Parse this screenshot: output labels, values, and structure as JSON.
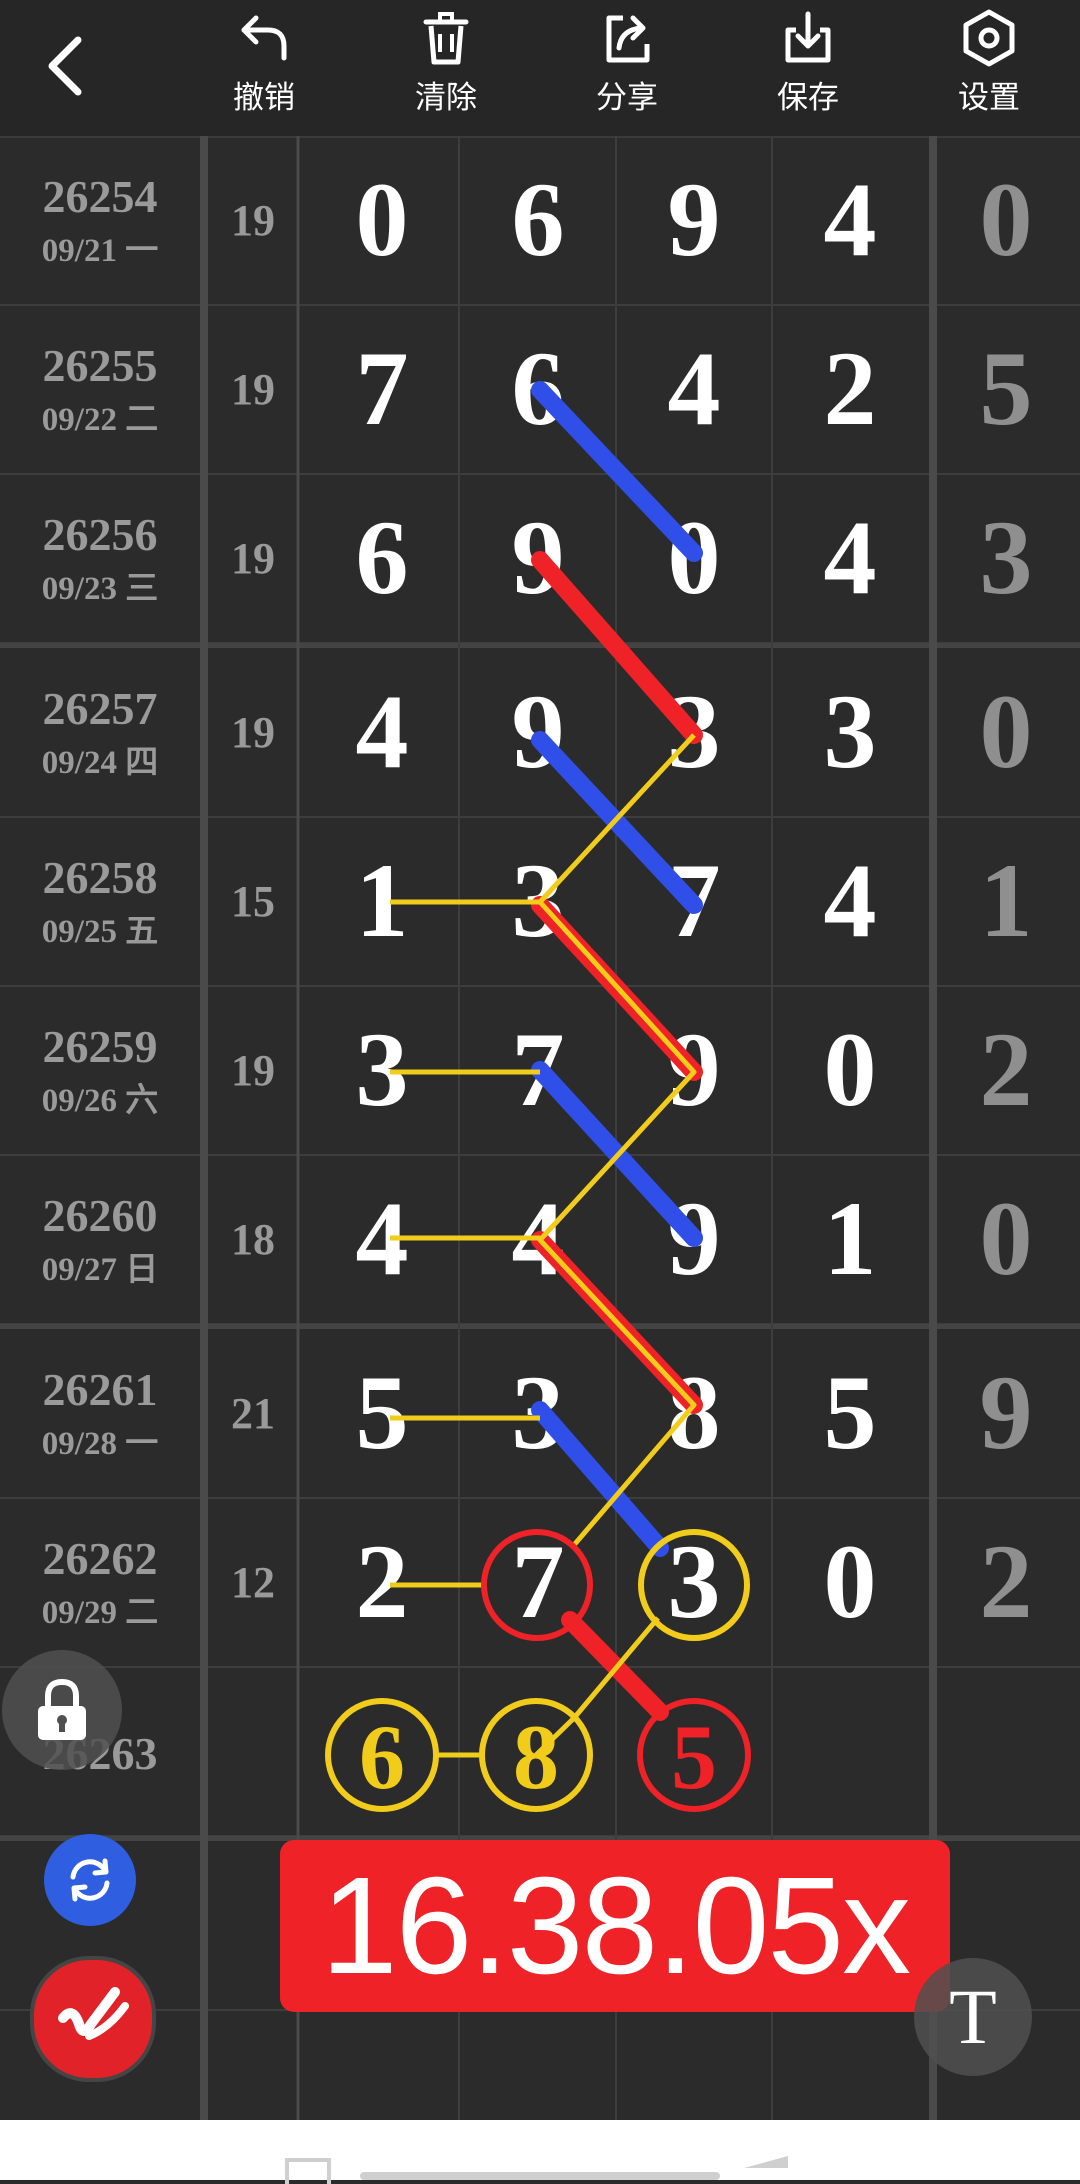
{
  "toolbar": {
    "undo_label": "撤销",
    "clear_label": "清除",
    "share_label": "分享",
    "save_label": "保存",
    "settings_label": "设置"
  },
  "rows": [
    {
      "issue": "26254",
      "date": "09/21 一",
      "sum": "19",
      "d": [
        "0",
        "6",
        "9",
        "4"
      ],
      "last": "0"
    },
    {
      "issue": "26255",
      "date": "09/22 二",
      "sum": "19",
      "d": [
        "7",
        "6",
        "4",
        "2"
      ],
      "last": "5"
    },
    {
      "issue": "26256",
      "date": "09/23 三",
      "sum": "19",
      "d": [
        "6",
        "9",
        "0",
        "4"
      ],
      "last": "3"
    },
    {
      "issue": "26257",
      "date": "09/24 四",
      "sum": "19",
      "d": [
        "4",
        "9",
        "3",
        "3"
      ],
      "last": "0"
    },
    {
      "issue": "26258",
      "date": "09/25 五",
      "sum": "15",
      "d": [
        "1",
        "3",
        "7",
        "4"
      ],
      "last": "1"
    },
    {
      "issue": "26259",
      "date": "09/26 六",
      "sum": "19",
      "d": [
        "3",
        "7",
        "9",
        "0"
      ],
      "last": "2"
    },
    {
      "issue": "26260",
      "date": "09/27 日",
      "sum": "18",
      "d": [
        "4",
        "4",
        "9",
        "1"
      ],
      "last": "0"
    },
    {
      "issue": "26261",
      "date": "09/28 一",
      "sum": "21",
      "d": [
        "5",
        "3",
        "8",
        "5"
      ],
      "last": "9"
    },
    {
      "issue": "26262",
      "date": "09/29 二",
      "sum": "12",
      "d": [
        "2",
        "7",
        "3",
        "0"
      ],
      "last": "2"
    }
  ],
  "next_issue": "26263",
  "predicted": {
    "yellow_1": "6",
    "yellow_2": "8",
    "red_3": "5"
  },
  "result_text": "16.38.05x",
  "text_tool_label": "T",
  "colors": {
    "background": "#2b2b2b",
    "red": "#ee2227",
    "blue": "#2f4fe8",
    "yellow": "#f2cc1a",
    "refresh_blue": "#2f5fe0"
  }
}
